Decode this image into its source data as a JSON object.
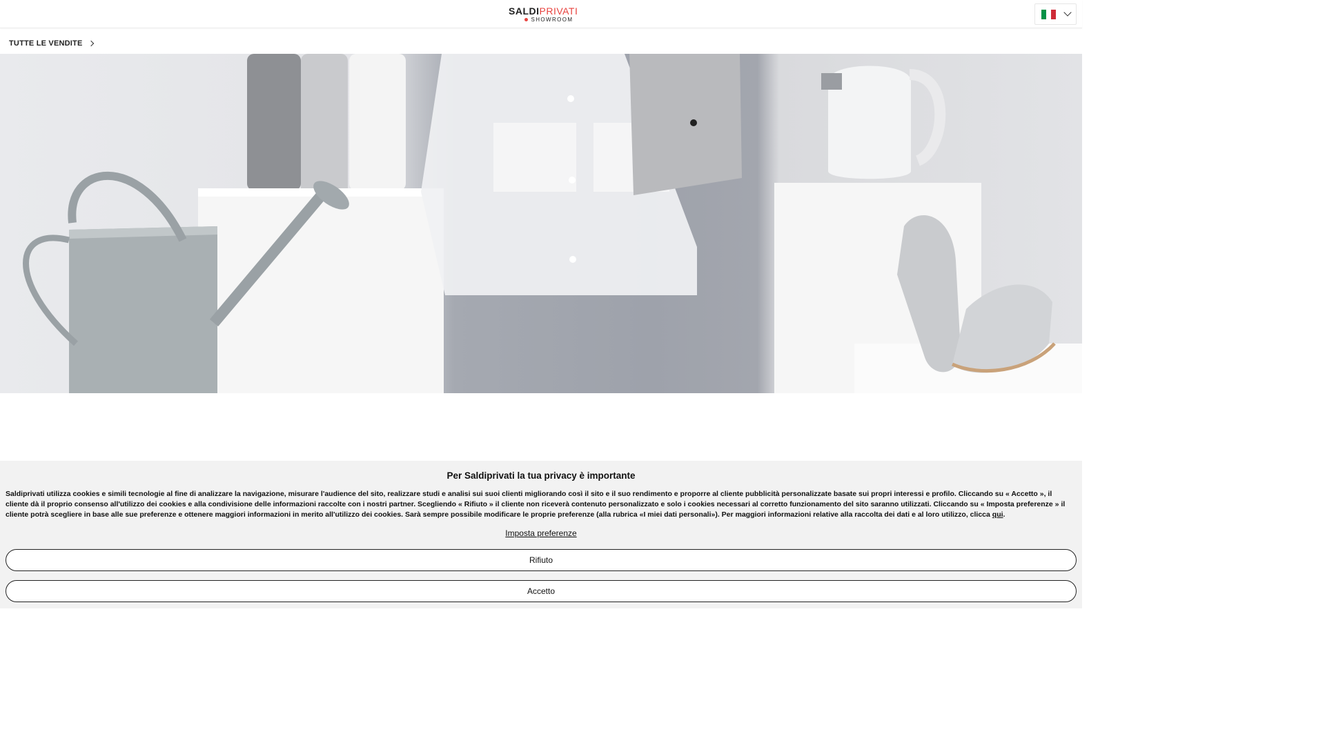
{
  "header": {
    "logo_part1": "SALDI",
    "logo_part2": "PRIVATI",
    "logo_sub": "SHOWROOM",
    "language": {
      "flag_colors": [
        "#009246",
        "#ffffff",
        "#ce2b37"
      ],
      "icon": "chevron-down-icon"
    }
  },
  "breadcrumb": {
    "label": "TUTTE LE VENDITE",
    "icon": "chevron-right-icon"
  },
  "colors": {
    "brand_red": "#e8433f",
    "panel_bg": "#f2f2f2"
  },
  "cookie_banner": {
    "title": "Per Saldiprivati la tua privacy è importante",
    "body": "Saldiprivati utilizza cookies e simili tecnologie al fine di analizzare la navigazione, misurare l'audience del sito, realizzare studi e analisi sui suoi clienti migliorando così il sito e il suo rendimento e proporre al cliente pubblicità personalizzate basate sui propri interessi e profilo. Cliccando su « Accetto », il cliente dà il proprio consenso all'utilizzo dei cookies e alla condivisione delle informazioni raccolte con i nostri partner. Scegliendo « Rifiuto » il cliente non riceverà contenuto personalizzato e solo i cookies necessari al corretto funzionamento del sito saranno utilizzati. Cliccando su « Imposta preferenze » il cliente potrà scegliere in base alle sue preferenze e ottenere maggiori informazioni in merito all'utilizzo dei cookies. Sarà sempre possibile modificare le proprie preferenze (alla rubrica «I miei dati personali»). Per maggiori informazioni relative alla raccolta dei dati e al loro utilizzo, clicca ",
    "link_label": "qui",
    "body_end": ".",
    "preferences_label": "Imposta preferenze",
    "reject_label": "Rifiuto",
    "accept_label": "Accetto"
  }
}
